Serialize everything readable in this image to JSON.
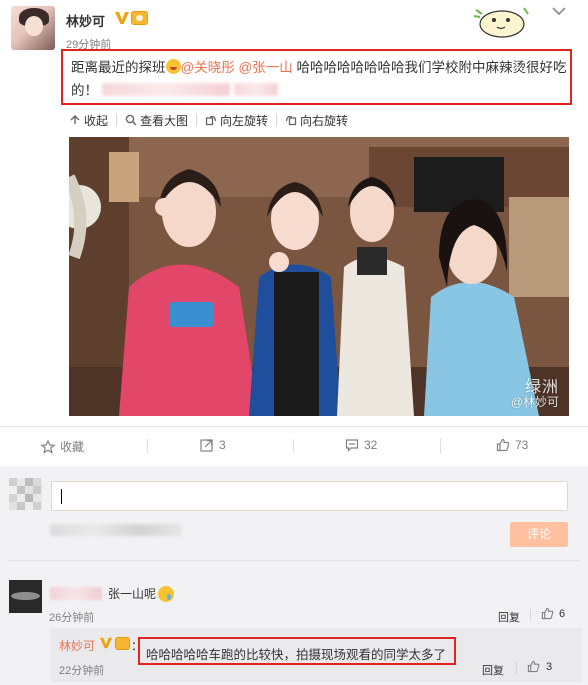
{
  "post": {
    "author": "林妙可",
    "time": "29分钟前",
    "text_prefix": "距离最近的探班",
    "mention_1": "@关晓彤",
    "mention_2": "@张一山",
    "text_suffix": " 哈哈哈哈哈哈哈哈我们学校附中麻辣烫很好吃的！",
    "icons": {
      "verified": "verified-v-icon",
      "member": "vip-member-icon",
      "emoji": "laughing-face-emoji"
    }
  },
  "image_toolbar": {
    "collapse": "收起",
    "view_large": "查看大图",
    "rotate_left": "向左旋转",
    "rotate_right": "向右旋转"
  },
  "photo": {
    "watermark_1": "绿洲",
    "watermark_2": "@林妙可"
  },
  "actions": {
    "favorite_label": "收藏",
    "repost_count": "3",
    "comment_count": "32",
    "like_count": "73"
  },
  "composer": {
    "submit_label": "评论",
    "submit_color": "#ffc09f"
  },
  "comments": [
    {
      "text": "张一山呢",
      "time": "26分钟前",
      "reply_label": "回复",
      "like_count": "6",
      "reply": {
        "author": "林妙可",
        "colon": "：",
        "text": "哈哈哈哈哈车跑的比较快，拍摄现场观看的同学太多了",
        "time": "22分钟前",
        "reply_label": "回复",
        "like_count": "3"
      }
    }
  ],
  "colors": {
    "accent": "#eb7350",
    "highlight_border": "#e1241e",
    "link": "#eb7350",
    "muted": "#808080"
  }
}
